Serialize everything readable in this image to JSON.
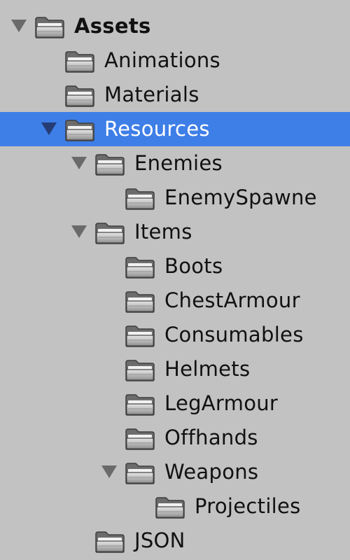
{
  "tree": {
    "items": [
      {
        "label": "Assets",
        "depth": 0,
        "expandable": true,
        "expanded": true,
        "bold": true,
        "selected": false
      },
      {
        "label": "Animations",
        "depth": 1,
        "expandable": false,
        "expanded": false,
        "bold": false,
        "selected": false
      },
      {
        "label": "Materials",
        "depth": 1,
        "expandable": false,
        "expanded": false,
        "bold": false,
        "selected": false
      },
      {
        "label": "Resources",
        "depth": 1,
        "expandable": true,
        "expanded": true,
        "bold": false,
        "selected": true
      },
      {
        "label": "Enemies",
        "depth": 2,
        "expandable": true,
        "expanded": true,
        "bold": false,
        "selected": false
      },
      {
        "label": "EnemySpawne",
        "depth": 3,
        "expandable": false,
        "expanded": false,
        "bold": false,
        "selected": false
      },
      {
        "label": "Items",
        "depth": 2,
        "expandable": true,
        "expanded": true,
        "bold": false,
        "selected": false
      },
      {
        "label": "Boots",
        "depth": 3,
        "expandable": false,
        "expanded": false,
        "bold": false,
        "selected": false
      },
      {
        "label": "ChestArmour",
        "depth": 3,
        "expandable": false,
        "expanded": false,
        "bold": false,
        "selected": false
      },
      {
        "label": "Consumables",
        "depth": 3,
        "expandable": false,
        "expanded": false,
        "bold": false,
        "selected": false
      },
      {
        "label": "Helmets",
        "depth": 3,
        "expandable": false,
        "expanded": false,
        "bold": false,
        "selected": false
      },
      {
        "label": "LegArmour",
        "depth": 3,
        "expandable": false,
        "expanded": false,
        "bold": false,
        "selected": false
      },
      {
        "label": "Offhands",
        "depth": 3,
        "expandable": false,
        "expanded": false,
        "bold": false,
        "selected": false
      },
      {
        "label": "Weapons",
        "depth": 3,
        "expandable": true,
        "expanded": true,
        "bold": false,
        "selected": false
      },
      {
        "label": "Projectiles",
        "depth": 4,
        "expandable": false,
        "expanded": false,
        "bold": false,
        "selected": false
      },
      {
        "label": "JSON",
        "depth": 2,
        "expandable": false,
        "expanded": false,
        "bold": false,
        "selected": false
      }
    ],
    "icon": "folder-icon",
    "expand_icon": "expand-arrow-icon"
  },
  "colors": {
    "background": "#c2c2c2",
    "selection": "#3e7ee7",
    "text": "#111111",
    "selected_text": "#ffffff",
    "arrow": "#6a6a6a",
    "folder_light": "#dcdcdc",
    "folder_dark": "#545454"
  }
}
